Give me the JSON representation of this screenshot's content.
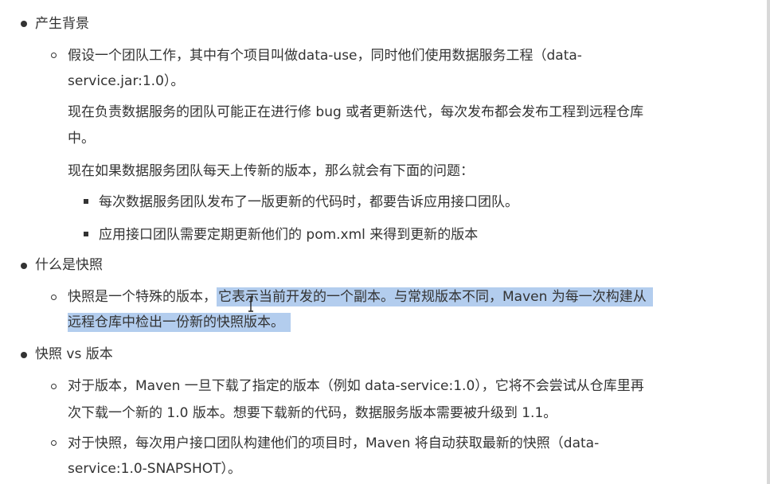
{
  "sections": [
    {
      "title": "产生背景",
      "paragraphs": {
        "p1_line1": "假设一个团队工作，其中有个项目叫做data-use，同时他们使用数据服务工程（data-",
        "p1_line2": "service.jar:1.0）。",
        "p2_line1": "现在负责数据服务的团队可能正在进行修 bug 或者更新迭代，每次发布都会发布工程到远程仓库",
        "p2_line2": "中。",
        "p3_line1": "现在如果数据服务团队每天上传新的版本，那么就会有下面的问题："
      },
      "sub_items": [
        "每次数据服务团队发布了一版更新的代码时，都要告诉应用接口团队。",
        "应用接口团队需要定期更新他们的 pom.xml 来得到更新的版本"
      ]
    },
    {
      "title": "什么是快照",
      "line1_plain": "快照是一个特殊的版本，",
      "line1_highlight": "它表示当前开发的一个副本。与常规版本不同，Maven 为每一次构建从",
      "line2_highlight": "远程仓库中检出一份新的快照版本。"
    },
    {
      "title": "快照 vs 版本",
      "item1_line1": "对于版本，Maven 一旦下载了指定的版本（例如 data-service:1.0），它将不会尝试从仓库里再",
      "item1_line2": "次下载一个新的 1.0 版本。想要下载新的代码，数据服务版本需要被升级到 1.1。",
      "item2_line1": "对于快照，每次用户接口团队构建他们的项目时，Maven 将自动获取最新的快照（data-",
      "item2_line2": "service:1.0-SNAPSHOT）。"
    }
  ],
  "colors": {
    "text": "#333333",
    "selection": "#b3cdee"
  }
}
